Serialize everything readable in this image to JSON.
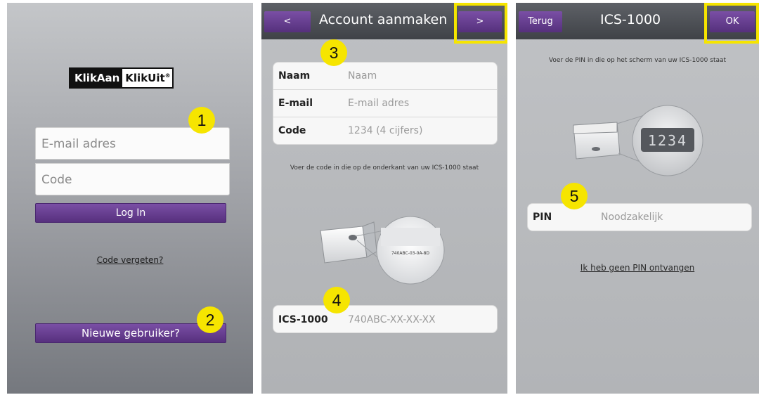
{
  "screen1": {
    "logo_left": "KlikAan",
    "logo_right": "KlikUit",
    "logo_mark": "®",
    "email_placeholder": "E-mail adres",
    "code_placeholder": "Code",
    "login_label": "Log In",
    "forgot_link": "Code vergeten?",
    "new_user_label": "Nieuwe gebruiker?",
    "badges": [
      "1",
      "2"
    ]
  },
  "screen2": {
    "back_label": "<",
    "title": "Account aanmaken",
    "next_label": ">",
    "badges": [
      "3",
      "4"
    ],
    "fields": [
      {
        "label": "Naam",
        "placeholder": "Naam"
      },
      {
        "label": "E-mail",
        "placeholder": "E-mail adres"
      },
      {
        "label": "Code",
        "placeholder": "1234 (4 cijfers)"
      }
    ],
    "instruction": "Voer de code in die op de onderkant van uw ICS-1000 staat",
    "device_code": "740ABC-03-0A-8D",
    "ics_label": "ICS-1000",
    "ics_placeholder": "740ABC-XX-XX-XX"
  },
  "screen3": {
    "back_label": "Terug",
    "title": "ICS-1000",
    "ok_label": "OK",
    "instruction": "Voer de PIN in die op het scherm van uw ICS-1000 staat",
    "display_pin": "1234",
    "badge": "5",
    "pin_label": "PIN",
    "pin_placeholder": "Noodzakelijk",
    "no_pin_link": "Ik heb geen PIN ontvangen"
  },
  "colors": {
    "accent_purple": "#6a3f96",
    "highlight_yellow": "#f6e500",
    "header_dark": "#4a4d52"
  }
}
